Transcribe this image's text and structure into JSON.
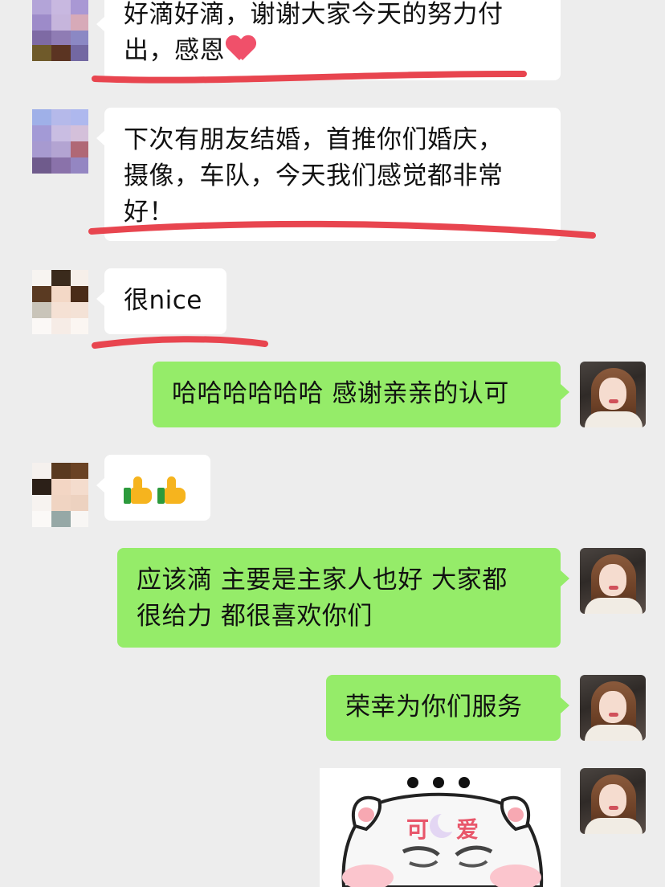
{
  "messages": [
    {
      "sender": "other",
      "lines": [
        "好滴好滴，谢谢大家今天的努力付",
        "出，感恩"
      ],
      "emoji": "heart-emoji"
    },
    {
      "sender": "other",
      "lines": [
        "下次有朋友结婚，首推你们婚庆，",
        "摄像，车队，今天我们感觉都非常",
        "好！"
      ]
    },
    {
      "sender": "other",
      "text": "很nice"
    },
    {
      "sender": "me",
      "text": "哈哈哈哈哈哈 感谢亲亲的认可"
    },
    {
      "sender": "other",
      "emoji": "thumbs-up-emoji x2"
    },
    {
      "sender": "me",
      "lines": [
        "应该滴 主要是主家人也好 大家都",
        "很给力 都很喜欢你们"
      ]
    },
    {
      "sender": "me",
      "text": "荣幸为你们服务"
    },
    {
      "sender": "me",
      "sticker": {
        "text": "可爱"
      }
    }
  ],
  "colors": {
    "background": "#ededed",
    "incoming_bubble": "#ffffff",
    "outgoing_bubble": "#95ec69",
    "annotation_underline": "#e8454f"
  }
}
